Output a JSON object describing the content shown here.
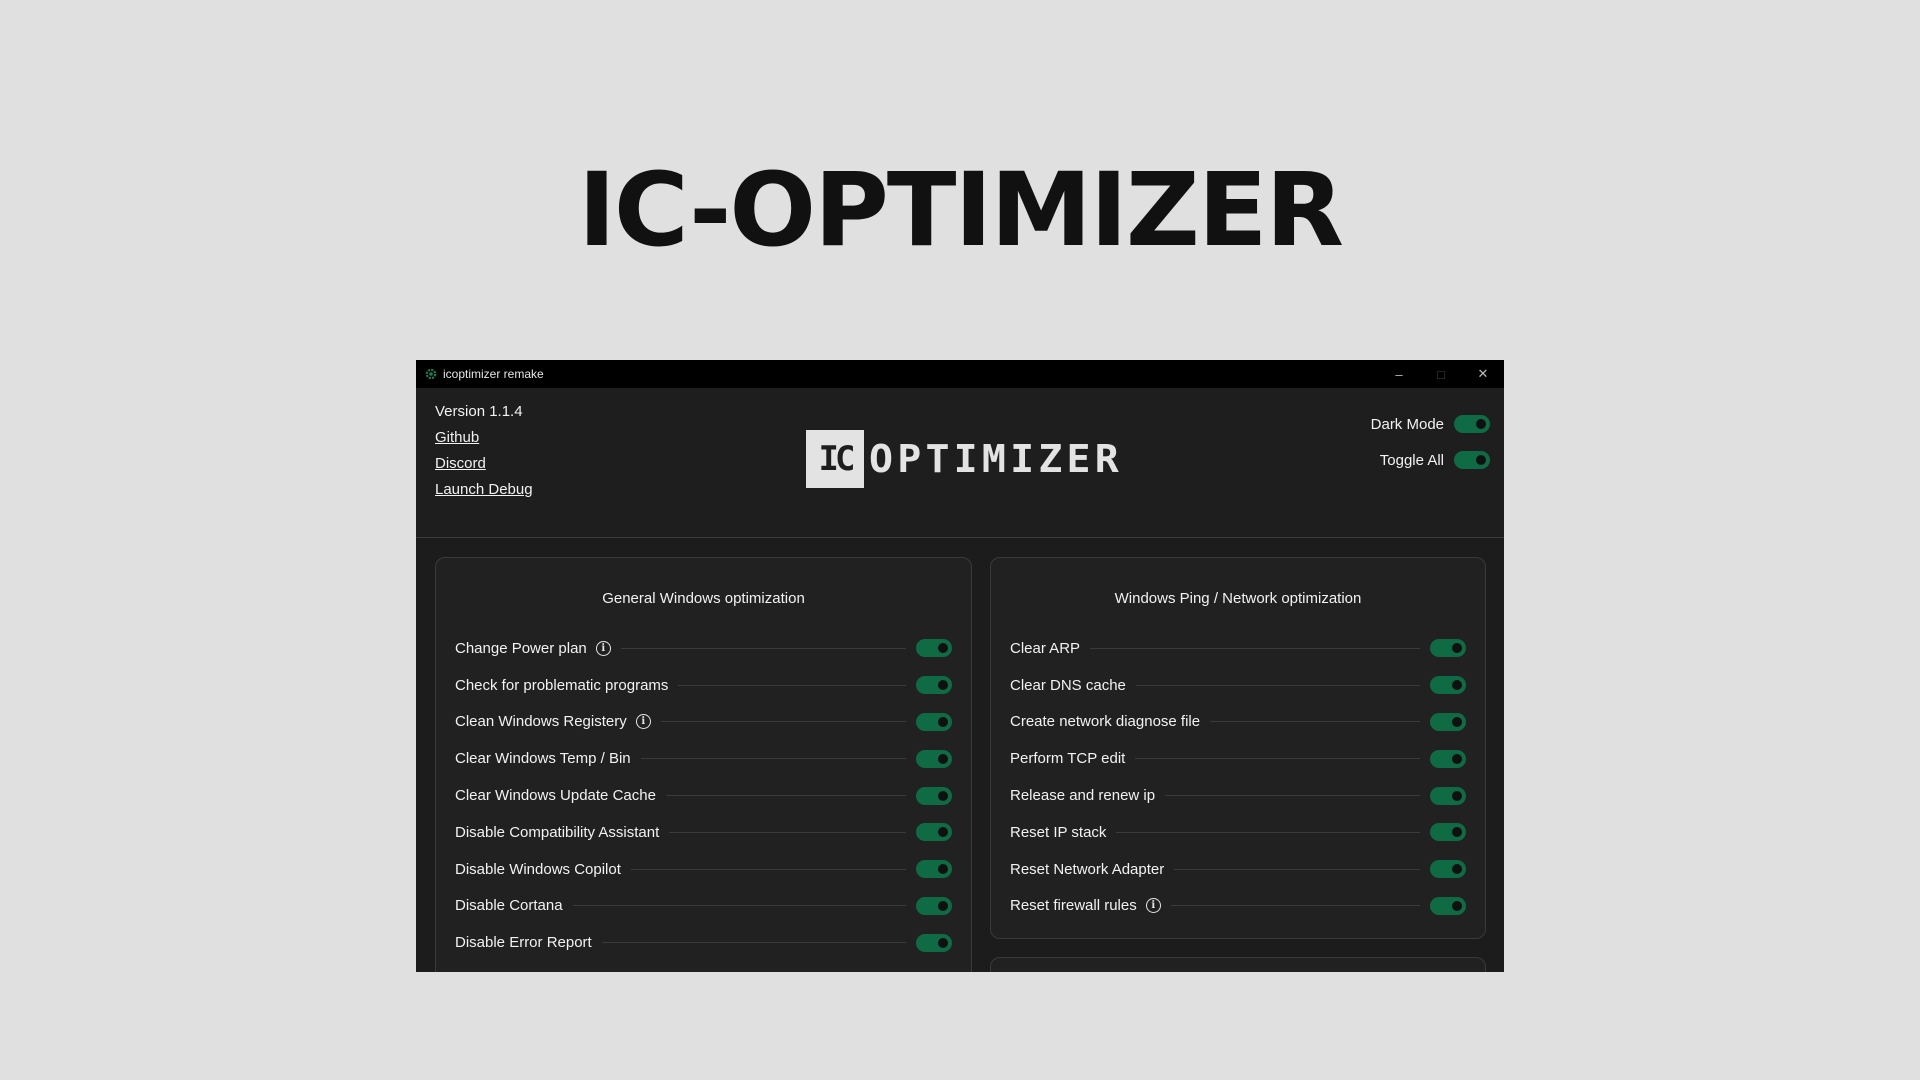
{
  "banner": {
    "title": "IC-OPTIMIZER"
  },
  "window": {
    "title": "icoptimizer remake",
    "controls": {
      "minimize": "–",
      "maximize": "□",
      "close": "✕"
    }
  },
  "header": {
    "version": "Version 1.1.4",
    "links": {
      "github": "Github",
      "discord": "Discord",
      "launch_debug": "Launch Debug"
    },
    "logo": {
      "box_text": "IC",
      "text": "OPTIMIZER"
    },
    "toggles": {
      "dark_mode": {
        "label": "Dark Mode",
        "on": true
      },
      "toggle_all": {
        "label": "Toggle All",
        "on": true
      }
    }
  },
  "accent_color": "#0e6b44",
  "general": {
    "title": "General Windows optimization",
    "items": [
      {
        "label": "Change Power plan",
        "info": true,
        "on": true
      },
      {
        "label": "Check for problematic programs",
        "info": false,
        "on": true
      },
      {
        "label": "Clean Windows Registery",
        "info": true,
        "on": true
      },
      {
        "label": "Clear Windows Temp / Bin",
        "info": false,
        "on": true
      },
      {
        "label": "Clear Windows Update Cache",
        "info": false,
        "on": true
      },
      {
        "label": "Disable Compatibility Assistant",
        "info": false,
        "on": true
      },
      {
        "label": "Disable Windows Copilot",
        "info": false,
        "on": true
      },
      {
        "label": "Disable Cortana",
        "info": false,
        "on": true
      },
      {
        "label": "Disable Error Report",
        "info": false,
        "on": true
      }
    ]
  },
  "network": {
    "title": "Windows Ping / Network optimization",
    "items": [
      {
        "label": "Clear ARP",
        "info": false,
        "on": true
      },
      {
        "label": "Clear DNS cache",
        "info": false,
        "on": true
      },
      {
        "label": "Create network diagnose file",
        "info": false,
        "on": true
      },
      {
        "label": "Perform TCP edit",
        "info": false,
        "on": true
      },
      {
        "label": "Release and renew ip",
        "info": false,
        "on": true
      },
      {
        "label": "Reset IP stack",
        "info": false,
        "on": true
      },
      {
        "label": "Reset Network Adapter",
        "info": false,
        "on": true
      },
      {
        "label": "Reset firewall rules",
        "info": true,
        "on": true
      }
    ]
  }
}
